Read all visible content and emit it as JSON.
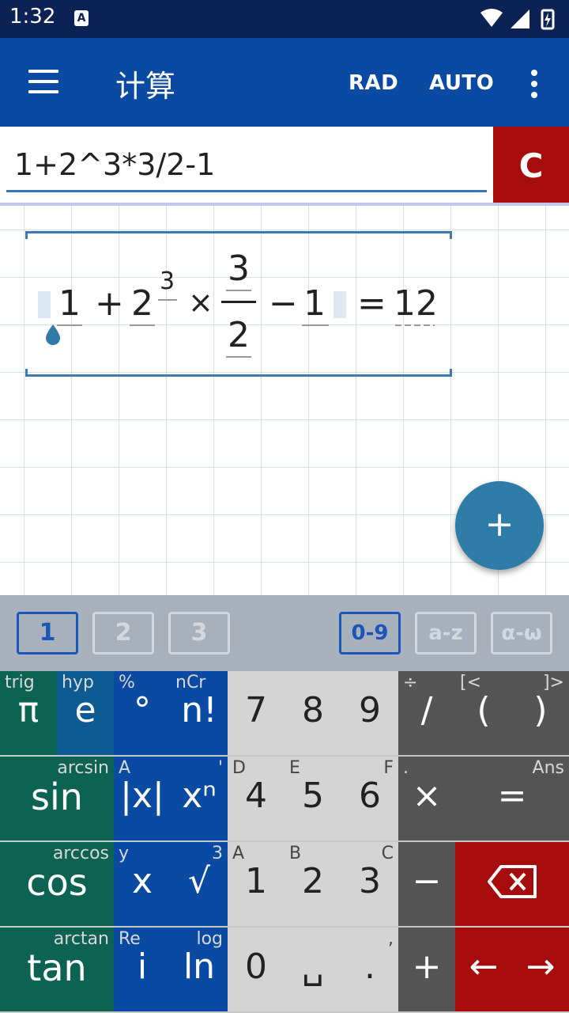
{
  "status_bar": {
    "time": "1:32",
    "notification_icon": "A"
  },
  "app_bar": {
    "title": "计算",
    "angle_mode": "RAD",
    "result_mode": "AUTO"
  },
  "input": {
    "expression": "1+2^3*3/2-1",
    "clear_label": "C"
  },
  "math_display": {
    "tokens": [
      "1",
      "+",
      "2",
      "3",
      "×",
      "3",
      "2",
      "−",
      "1",
      "=",
      "12"
    ],
    "result": "12"
  },
  "fab": {
    "label": "+"
  },
  "keyboard_tabs": {
    "pages": [
      "1",
      "2",
      "3"
    ],
    "sets": [
      "0-9",
      "a-z",
      "α-ω"
    ],
    "active_page": "1",
    "active_set": "0-9"
  },
  "keys": [
    {
      "main": "π",
      "sup_left": "trig",
      "sup_right": ""
    },
    {
      "main": "e",
      "sup_left": "hyp",
      "sup_right": ""
    },
    {
      "main": "°",
      "sup_left": "%",
      "sup_right": ""
    },
    {
      "main": "n!",
      "sup_left": "nCr",
      "sup_right": ""
    },
    {
      "main": "7",
      "sup_left": "",
      "sup_right": ""
    },
    {
      "main": "8",
      "sup_left": "",
      "sup_right": ""
    },
    {
      "main": "9",
      "sup_left": "",
      "sup_right": ""
    },
    {
      "main": "∕",
      "sup_left": "÷",
      "sup_right": ""
    },
    {
      "main": "(",
      "sup_left": "[<",
      "sup_right": ""
    },
    {
      "main": ")",
      "sup_left": "",
      "sup_right": "]>"
    },
    {
      "main": "sin",
      "sup_left": "",
      "sup_right": "arcsin"
    },
    {
      "main": "|x|",
      "sup_left": "A",
      "sup_right": ""
    },
    {
      "main": "xⁿ",
      "sup_left": "",
      "sup_right": "'"
    },
    {
      "main": "4",
      "sup_left": "D",
      "sup_right": ""
    },
    {
      "main": "5",
      "sup_left": "E",
      "sup_right": ""
    },
    {
      "main": "6",
      "sup_left": "",
      "sup_right": "F"
    },
    {
      "main": "×",
      "sup_left": ".",
      "sup_right": ""
    },
    {
      "main": "=",
      "sup_left": "",
      "sup_right": "Ans"
    },
    {
      "main": "cos",
      "sup_left": "",
      "sup_right": "arccos"
    },
    {
      "main": "x",
      "sup_left": "y",
      "sup_right": ""
    },
    {
      "main": "√",
      "sup_left": "",
      "sup_right": "3"
    },
    {
      "main": "1",
      "sup_left": "A",
      "sup_right": ""
    },
    {
      "main": "2",
      "sup_left": "B",
      "sup_right": ""
    },
    {
      "main": "3",
      "sup_left": "",
      "sup_right": "C"
    },
    {
      "main": "−",
      "sup_left": "",
      "sup_right": ""
    },
    {
      "main": "",
      "sup_left": "",
      "sup_right": ""
    },
    {
      "main": "tan",
      "sup_left": "",
      "sup_right": "arctan"
    },
    {
      "main": "i",
      "sup_left": "Re",
      "sup_right": ""
    },
    {
      "main": "ln",
      "sup_left": "",
      "sup_right": "log"
    },
    {
      "main": "0",
      "sup_left": "",
      "sup_right": ""
    },
    {
      "main": "␣",
      "sup_left": "",
      "sup_right": ""
    },
    {
      "main": ".",
      "sup_left": "",
      "sup_right": ","
    },
    {
      "main": "+",
      "sup_left": "",
      "sup_right": ""
    },
    {
      "main": "←",
      "sup_left": "",
      "sup_right": ""
    },
    {
      "main": "→",
      "sup_left": "",
      "sup_right": ""
    }
  ],
  "colors": {
    "app_bar": "#0b4aa2",
    "status_bar": "#0c2254",
    "clear": "#a70c0c",
    "fab": "#2f7ca9",
    "accent": "#1a55b8"
  }
}
